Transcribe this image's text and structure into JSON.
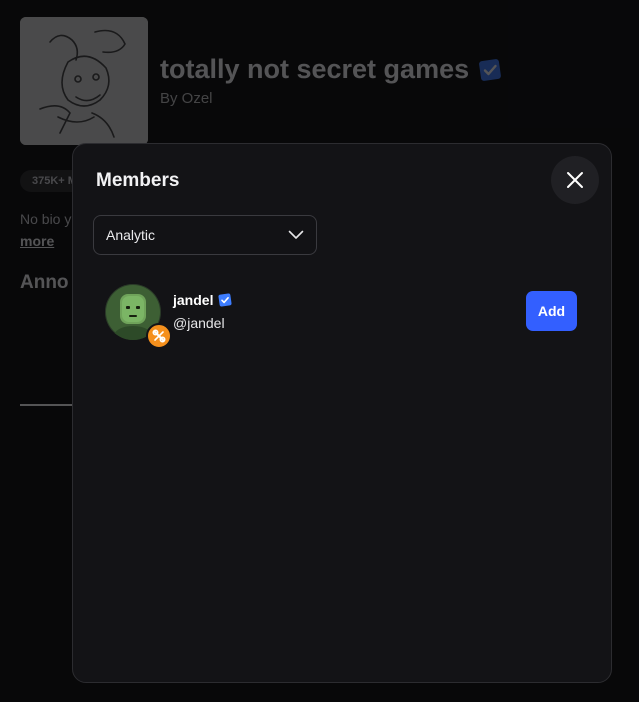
{
  "background": {
    "group_title": "totally not secret games",
    "group_owner": "By Ozel",
    "stat_pill": "375K+ M",
    "bio_text": "No bio y",
    "more_link": "more",
    "section_heading": "Anno"
  },
  "modal": {
    "title": "Members",
    "role_filter": {
      "selected": "Analytic"
    },
    "members": [
      {
        "display_name": "jandel",
        "handle": "@jandel",
        "action_label": "Add",
        "verified": true
      }
    ]
  },
  "colors": {
    "verified_badge": "#3d7dff",
    "primary_button": "#335fff",
    "role_badge": "#f5901d"
  },
  "icons": [
    "verified-badge-icon",
    "close-icon",
    "chevron-down-icon",
    "wrench-icon"
  ]
}
